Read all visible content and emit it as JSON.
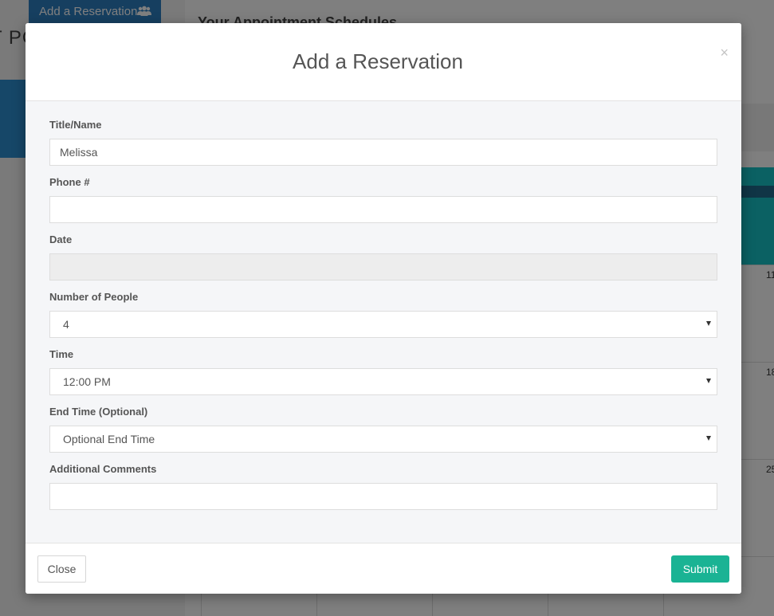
{
  "background": {
    "sidebar_title": "T PO",
    "add_button_label": "Add a Reservation",
    "main_title": "Your Appointment Schedules",
    "calendar_numbers": [
      "11",
      "18",
      "25"
    ]
  },
  "modal": {
    "title": "Add a Reservation",
    "close_x": "×",
    "fields": {
      "title_name": {
        "label": "Title/Name",
        "value": "Melissa"
      },
      "phone": {
        "label": "Phone #",
        "value": ""
      },
      "date": {
        "label": "Date",
        "value": ""
      },
      "people": {
        "label": "Number of People",
        "value": "4"
      },
      "time": {
        "label": "Time",
        "value": "12:00 PM"
      },
      "end_time": {
        "label": "End Time (Optional)",
        "value": "Optional End Time"
      },
      "comments": {
        "label": "Additional Comments",
        "value": ""
      }
    },
    "footer": {
      "close_label": "Close",
      "submit_label": "Submit"
    }
  },
  "colors": {
    "primary_blue": "#2d7fc1",
    "sidebar_blue": "#2c8fd1",
    "teal": "#17c3c7",
    "submit_green": "#1ab394"
  }
}
